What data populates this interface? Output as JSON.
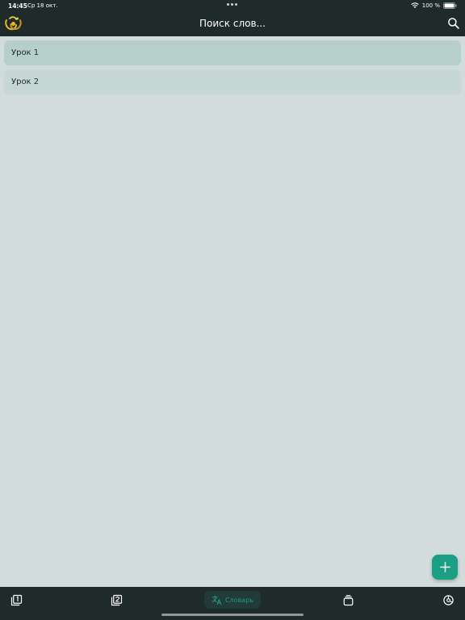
{
  "status_bar": {
    "time": "14:45",
    "date": "Ср 18 окт.",
    "battery": "100 %"
  },
  "header": {
    "title": "Поиск слов..."
  },
  "lessons": [
    {
      "label": "Урок 1"
    },
    {
      "label": "Урок 2"
    }
  ],
  "bottom_nav": {
    "active_label": "Словарь"
  },
  "colors": {
    "accent": "#1a9e84",
    "bar": "#1f2a2b",
    "background": "#d2dcdc"
  }
}
